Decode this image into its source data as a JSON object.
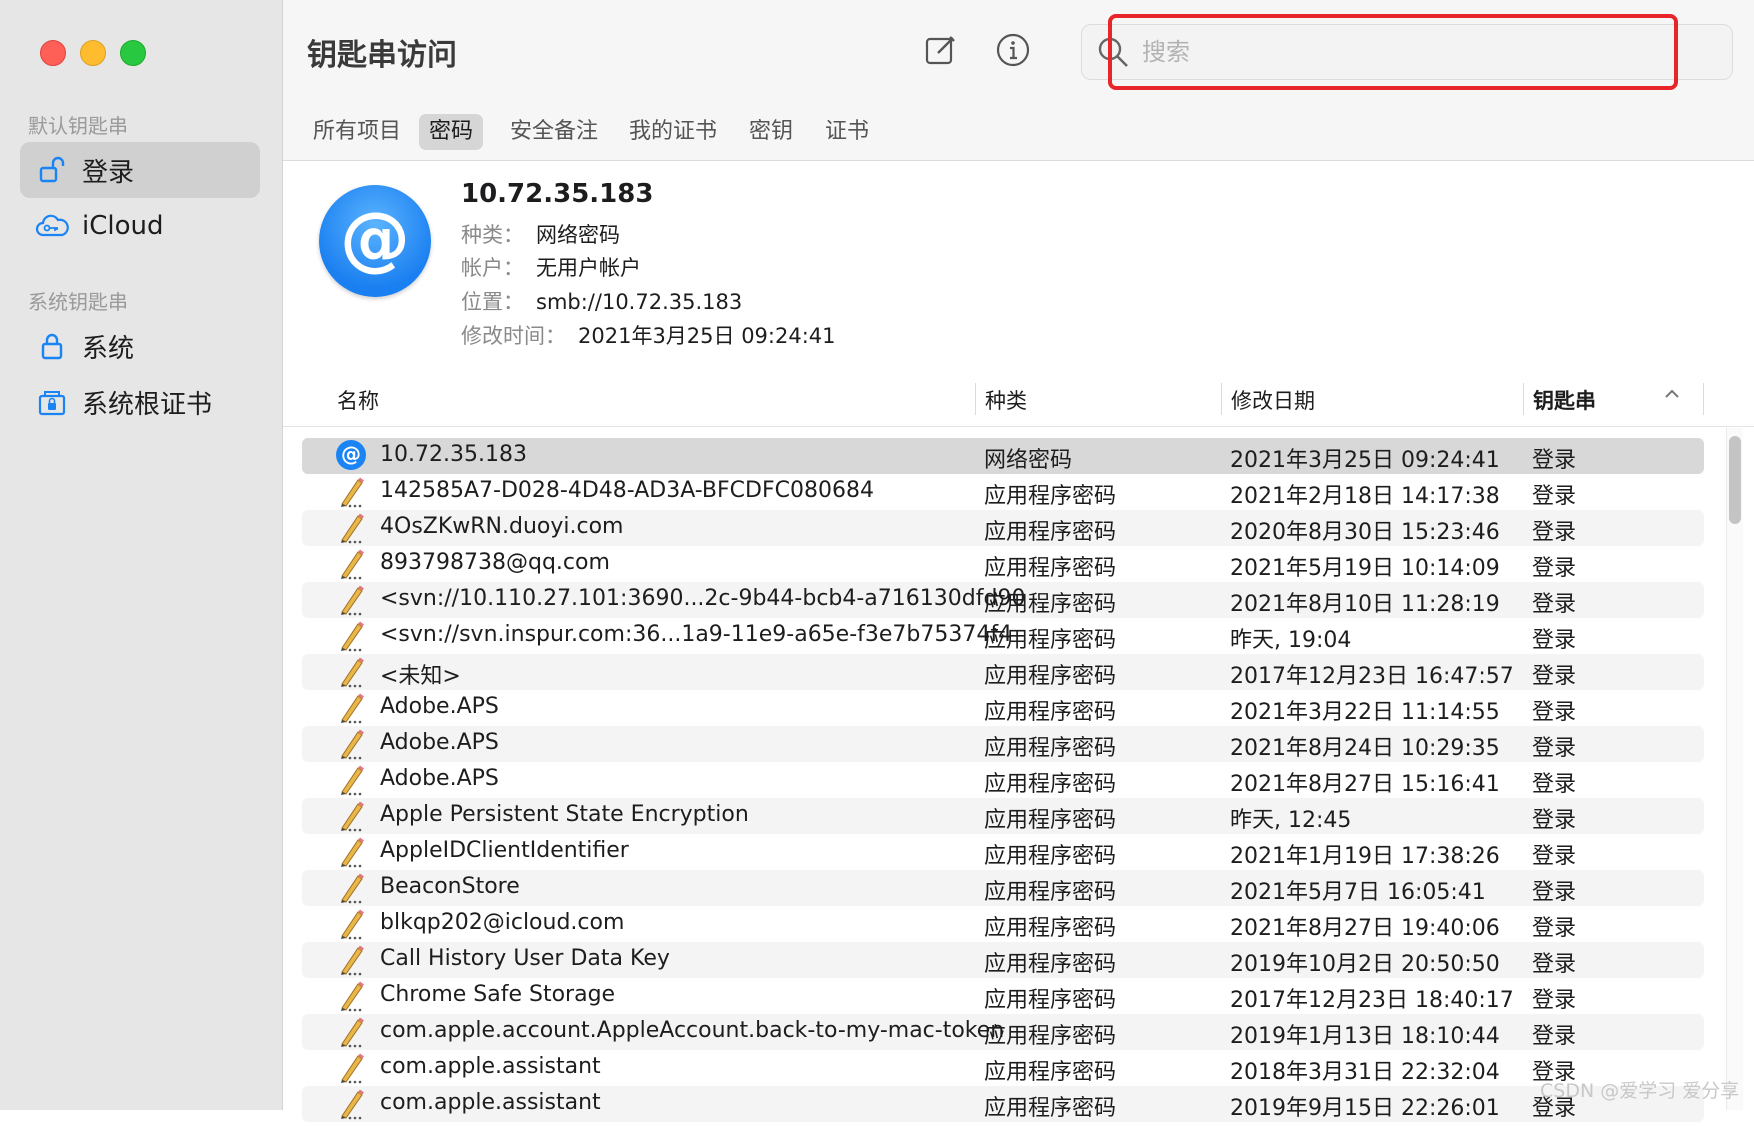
{
  "sidebar": {
    "section_default": "默认钥匙串",
    "section_system": "系统钥匙串",
    "items": [
      {
        "label": "登录",
        "icon": "unlock-icon"
      },
      {
        "label": "iCloud",
        "icon": "icloud-key-icon"
      },
      {
        "label": "系统",
        "icon": "lock-icon"
      },
      {
        "label": "系统根证书",
        "icon": "certificate-lock-icon"
      }
    ]
  },
  "toolbar": {
    "title": "钥匙串访问",
    "compose_icon": "compose-icon",
    "info_icon": "info-icon",
    "search_placeholder": "搜索",
    "search_value": ""
  },
  "tabs": [
    "所有项目",
    "密码",
    "安全备注",
    "我的证书",
    "密钥",
    "证书"
  ],
  "active_tab": "密码",
  "detail": {
    "title": "10.72.35.183",
    "kind_label": "种类：",
    "kind_value": "网络密码",
    "account_label": "帐户：",
    "account_value": "无用户帐户",
    "where_label": "位置：",
    "where_value": "smb://10.72.35.183",
    "modified_label": "修改时间：",
    "modified_value": "2021年3月25日 09:24:41"
  },
  "table": {
    "headers": {
      "name": "名称",
      "kind": "种类",
      "date": "修改日期",
      "chain": "钥匙串"
    },
    "rows": [
      {
        "name": "10.72.35.183",
        "kind": "网络密码",
        "date": "2021年3月25日 09:24:41",
        "chain": "登录",
        "icon": "at-icon"
      },
      {
        "name": "142585A7-D028-4D48-AD3A-BFCDFC080684",
        "kind": "应用程序密码",
        "date": "2021年2月18日 14:17:38",
        "chain": "登录",
        "icon": "pencil-icon"
      },
      {
        "name": "4OsZKwRN.duoyi.com",
        "kind": "应用程序密码",
        "date": "2020年8月30日 15:23:46",
        "chain": "登录",
        "icon": "pencil-icon"
      },
      {
        "name": "893798738@qq.com",
        "kind": "应用程序密码",
        "date": "2021年5月19日 10:14:09",
        "chain": "登录",
        "icon": "pencil-icon"
      },
      {
        "name": "<svn://10.110.27.101:3690...2c-9b44-bcb4-a716130dfd90",
        "kind": "应用程序密码",
        "date": "2021年8月10日 11:28:19",
        "chain": "登录",
        "icon": "pencil-icon"
      },
      {
        "name": "<svn://svn.inspur.com:36...1a9-11e9-a65e-f3e7b75374f4",
        "kind": "应用程序密码",
        "date": "昨天, 19:04",
        "chain": "登录",
        "icon": "pencil-icon"
      },
      {
        "name": "<未知>",
        "kind": "应用程序密码",
        "date": "2017年12月23日 16:47:57",
        "chain": "登录",
        "icon": "pencil-icon"
      },
      {
        "name": "Adobe.APS",
        "kind": "应用程序密码",
        "date": "2021年3月22日 11:14:55",
        "chain": "登录",
        "icon": "pencil-icon"
      },
      {
        "name": "Adobe.APS",
        "kind": "应用程序密码",
        "date": "2021年8月24日 10:29:35",
        "chain": "登录",
        "icon": "pencil-icon"
      },
      {
        "name": "Adobe.APS",
        "kind": "应用程序密码",
        "date": "2021年8月27日 15:16:41",
        "chain": "登录",
        "icon": "pencil-icon"
      },
      {
        "name": "Apple Persistent State Encryption",
        "kind": "应用程序密码",
        "date": "昨天, 12:45",
        "chain": "登录",
        "icon": "pencil-icon"
      },
      {
        "name": "AppleIDClientIdentifier",
        "kind": "应用程序密码",
        "date": "2021年1月19日 17:38:26",
        "chain": "登录",
        "icon": "pencil-icon"
      },
      {
        "name": "BeaconStore",
        "kind": "应用程序密码",
        "date": "2021年5月7日 16:05:41",
        "chain": "登录",
        "icon": "pencil-icon"
      },
      {
        "name": "blkqp202@icloud.com",
        "kind": "应用程序密码",
        "date": "2021年8月27日 19:40:06",
        "chain": "登录",
        "icon": "pencil-icon"
      },
      {
        "name": "Call History User Data Key",
        "kind": "应用程序密码",
        "date": "2019年10月2日 20:50:50",
        "chain": "登录",
        "icon": "pencil-icon"
      },
      {
        "name": "Chrome Safe Storage",
        "kind": "应用程序密码",
        "date": "2017年12月23日 18:40:17",
        "chain": "登录",
        "icon": "pencil-icon"
      },
      {
        "name": "com.apple.account.AppleAccount.back-to-my-mac-token",
        "kind": "应用程序密码",
        "date": "2019年1月13日 18:10:44",
        "chain": "登录",
        "icon": "pencil-icon"
      },
      {
        "name": "com.apple.assistant",
        "kind": "应用程序密码",
        "date": "2018年3月31日 22:32:04",
        "chain": "登录",
        "icon": "pencil-icon"
      },
      {
        "name": "com.apple.assistant",
        "kind": "应用程序密码",
        "date": "2019年9月15日 22:26:01",
        "chain": "登录",
        "icon": "pencil-icon"
      }
    ]
  },
  "watermark": "CSDN @爱学习 爱分享",
  "colors": {
    "highlight": "#e8262a",
    "accent_blue": "#1a84f5",
    "sidebar_bg": "#e6e6e6",
    "selected_row": "#d8d8d8"
  }
}
